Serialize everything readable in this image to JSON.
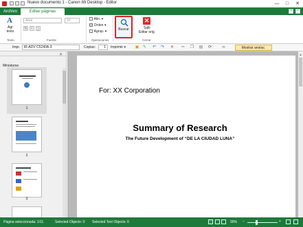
{
  "window": {
    "title": "Nuevo documento 1 - Canon iW Desktop - Editor",
    "controls": [
      "—",
      "□",
      "✕"
    ]
  },
  "tabs": {
    "file": "Archivo",
    "edit": "Editar páginas originales"
  },
  "ribbon": {
    "text_group": {
      "add_text_label": "Agr\ntexto",
      "group_label": "Texto"
    },
    "font_group": {
      "font_placeholder": "Arial",
      "size_placeholder": "10",
      "format_buttons": [
        "N",
        "K",
        "S"
      ],
      "group_label": "Fuente"
    },
    "operations_group": {
      "items": [
        "Alin. ▾",
        "Orden ▾",
        "Agrup. ▾"
      ],
      "group_label": "Operaciones"
    },
    "search_label": "Buscar",
    "exit_label": "Salir\nEditar orig.",
    "close_group_label": "Cerrar"
  },
  "toolbar": {
    "printer_label": "Impr.",
    "printer_value": "iR-ADV C5240A-3",
    "copies_label": "Copias:",
    "copies_value": "1",
    "print_button": "Imprimir ▾",
    "show_notes": "Mostrar anotac."
  },
  "thumbnails": {
    "title": "Miniaturas",
    "pages": [
      "1",
      "2",
      "3"
    ]
  },
  "document": {
    "for_text": "For: XX Corporation",
    "title": "Summary of Research",
    "subtitle": "The Future Development of “DE LA CIUDAD LUNA”"
  },
  "status": {
    "selected_page": "Página seleccionada: 1/11",
    "selected_objects": "Selected Objects: 0",
    "selected_text_objects": "Selected Text Objects: 0",
    "zoom": "90%"
  },
  "colors": {
    "accent": "#1e7a3b",
    "highlight": "#dd2222"
  }
}
